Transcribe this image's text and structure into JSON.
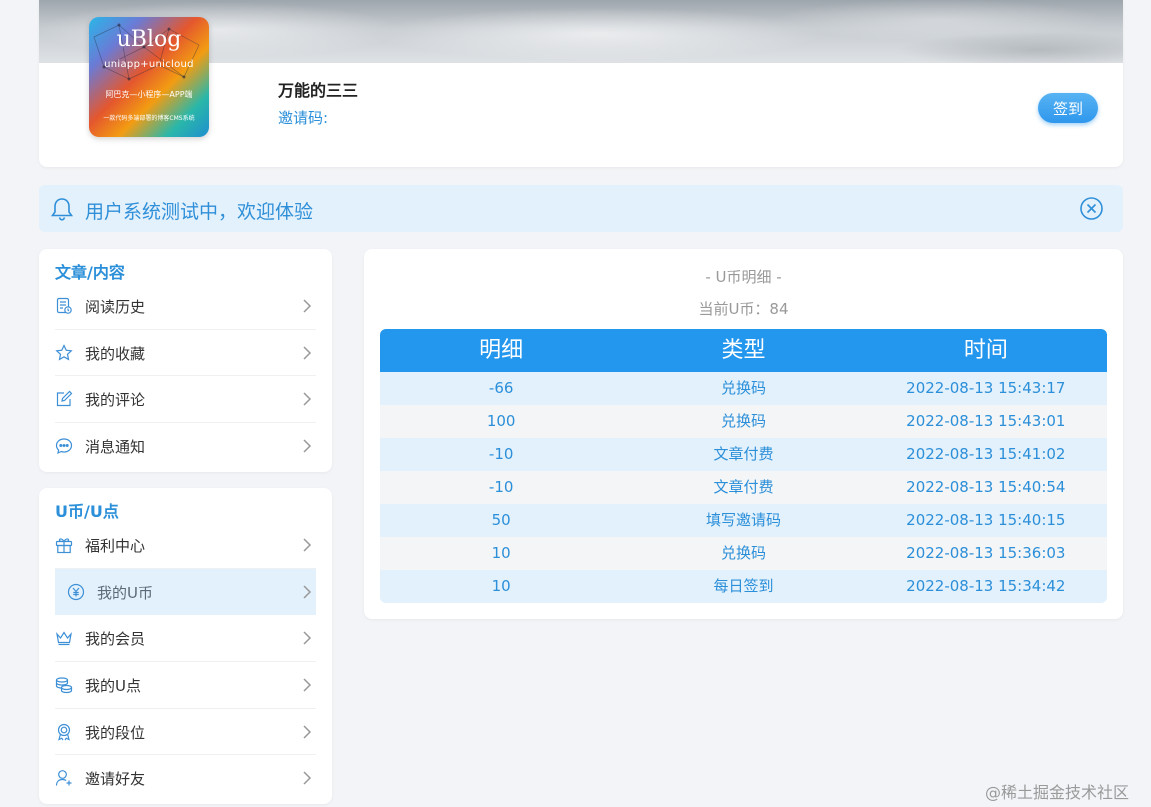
{
  "profile": {
    "logo": {
      "title": "uBlog",
      "subtitle": "uniapp+unicloud",
      "line3": "阿巴克—小程序—APP端",
      "line4": "一款代码多端部署的博客CMS系统"
    },
    "username": "万能的三三",
    "invite_label": "邀请码:",
    "signin_label": "签到"
  },
  "notice": {
    "text": "用户系统测试中，欢迎体验",
    "icon": "bell-icon",
    "close_icon": "close-circle-icon"
  },
  "menus": [
    {
      "title": "文章/内容",
      "items": [
        {
          "label": "阅读历史",
          "icon": "history-icon"
        },
        {
          "label": "我的收藏",
          "icon": "star-icon"
        },
        {
          "label": "我的评论",
          "icon": "edit-icon"
        },
        {
          "label": "消息通知",
          "icon": "message-icon"
        }
      ]
    },
    {
      "title": "U币/U点",
      "items": [
        {
          "label": "福利中心",
          "icon": "gift-icon"
        },
        {
          "label": "我的U币",
          "icon": "coin-icon",
          "active": true
        },
        {
          "label": "我的会员",
          "icon": "crown-icon"
        },
        {
          "label": "我的U点",
          "icon": "coins-stack-icon"
        },
        {
          "label": "我的段位",
          "icon": "medal-icon"
        },
        {
          "label": "邀请好友",
          "icon": "user-add-icon"
        }
      ]
    }
  ],
  "coin_detail": {
    "title": "- U币明细 -",
    "balance_text": "当前U币：84",
    "columns": [
      "明细",
      "类型",
      "时间"
    ],
    "rows": [
      [
        "-66",
        "兑换码",
        "2022-08-13 15:43:17"
      ],
      [
        "100",
        "兑换码",
        "2022-08-13 15:43:01"
      ],
      [
        "-10",
        "文章付费",
        "2022-08-13 15:41:02"
      ],
      [
        "-10",
        "文章付费",
        "2022-08-13 15:40:54"
      ],
      [
        "50",
        "填写邀请码",
        "2022-08-13 15:40:15"
      ],
      [
        "10",
        "兑换码",
        "2022-08-13 15:36:03"
      ],
      [
        "10",
        "每日签到",
        "2022-08-13 15:34:42"
      ]
    ]
  },
  "watermark": "@稀土掘金技术社区",
  "colors": {
    "accent": "#2396ee",
    "text_blue": "#2b8fd9",
    "row_alt": "#e3f1fc"
  }
}
